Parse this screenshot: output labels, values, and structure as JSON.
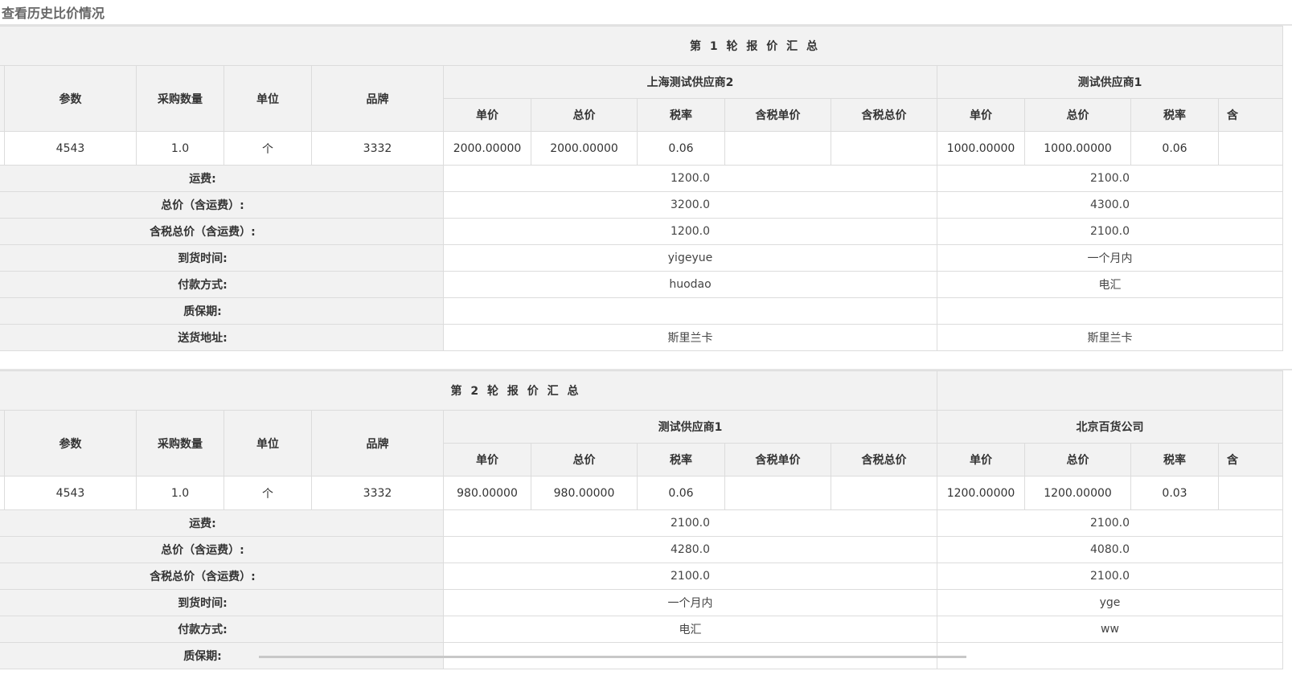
{
  "page": {
    "title": "查看历史比价情况"
  },
  "columns": {
    "param": "参数",
    "qty": "采购数量",
    "unit": "单位",
    "brand": "品牌",
    "price_cols": [
      "单价",
      "总价",
      "税率",
      "含税单价",
      "含税总价"
    ],
    "partial_col": "含"
  },
  "summary_labels": [
    "运费:",
    "总价（含运费）:",
    "含税总价（含运费）:",
    "到货时间:",
    "付款方式:",
    "质保期:",
    "送货地址:"
  ],
  "rounds": [
    {
      "title": "第 1 轮 报 价 汇 总",
      "item": {
        "param": "4543",
        "qty": "1.0",
        "unit": "个",
        "brand": "3332"
      },
      "suppliers": [
        {
          "name": "上海测试供应商2",
          "prices": [
            "2000.00000",
            "2000.00000",
            "0.06",
            "",
            ""
          ],
          "summary": [
            "1200.0",
            "3200.0",
            "1200.0",
            "yigeyue",
            "huodao",
            "",
            "斯里兰卡"
          ]
        },
        {
          "name": "测试供应商1",
          "prices": [
            "1000.00000",
            "1000.00000",
            "0.06",
            "",
            ""
          ],
          "summary": [
            "2100.0",
            "4300.0",
            "2100.0",
            "一个月内",
            "电汇",
            "",
            "斯里兰卡"
          ]
        }
      ]
    },
    {
      "title": "第 2 轮 报 价 汇 总",
      "item": {
        "param": "4543",
        "qty": "1.0",
        "unit": "个",
        "brand": "3332"
      },
      "suppliers": [
        {
          "name": "测试供应商1",
          "prices": [
            "980.00000",
            "980.00000",
            "0.06",
            "",
            ""
          ],
          "summary": [
            "2100.0",
            "4280.0",
            "2100.0",
            "一个月内",
            "电汇",
            ""
          ]
        },
        {
          "name": "北京百货公司",
          "prices": [
            "1200.00000",
            "1200.00000",
            "0.03",
            "",
            ""
          ],
          "summary": [
            "2100.0",
            "4080.0",
            "2100.0",
            "yge",
            "ww",
            ""
          ]
        }
      ]
    }
  ]
}
